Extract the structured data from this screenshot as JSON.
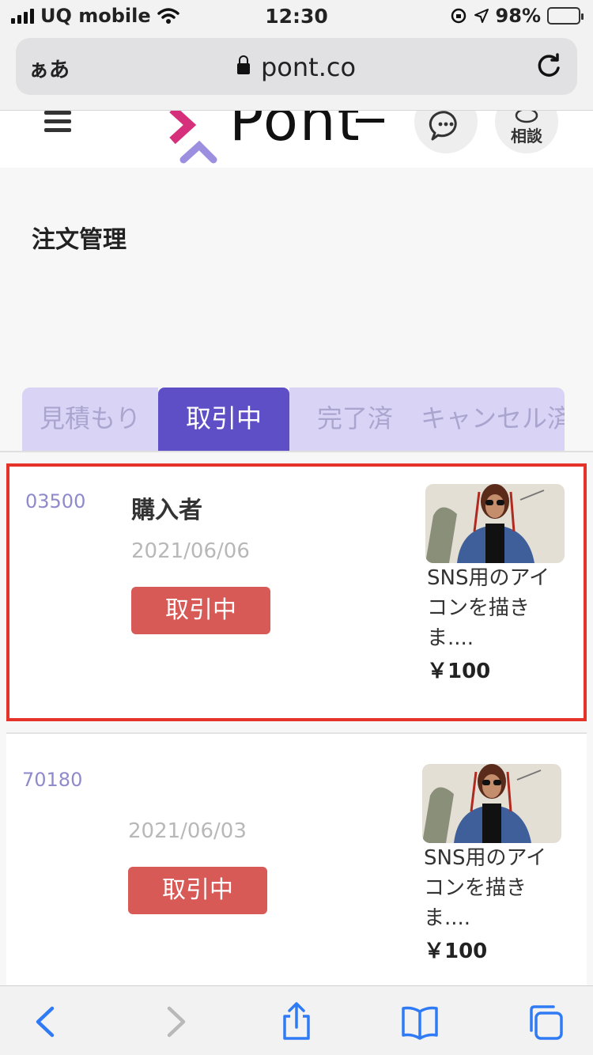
{
  "status_bar": {
    "carrier": "UQ mobile",
    "time": "12:30",
    "battery": "98%",
    "battery_level": 0.98
  },
  "browser": {
    "aa_label": "ぁあ",
    "domain": "pont.co"
  },
  "site": {
    "brand": "Pont",
    "line_button_label": "相談"
  },
  "page": {
    "title": "注文管理"
  },
  "tabs": [
    {
      "label": "見積もり",
      "active": false
    },
    {
      "label": "取引中",
      "active": true
    },
    {
      "label": "完了済",
      "active": false
    },
    {
      "label": "キャンセル済",
      "active": false
    }
  ],
  "orders": [
    {
      "id": "03500",
      "buyer": "購入者",
      "date": "2021/06/06",
      "status": "取引中",
      "product_title": "SNS用のアイコンを描きま....",
      "price": "￥100"
    },
    {
      "id": "70180",
      "buyer": "",
      "date": "2021/06/03",
      "status": "取引中",
      "product_title": "SNS用のアイコンを描きま....",
      "price": "￥100"
    }
  ],
  "colors": {
    "accent": "#5e4fc7",
    "tab_inactive": "#d9d4f6",
    "status_badge": "#d85a57",
    "order_id": "#8e8acb",
    "highlight_border": "#e5332a",
    "ios_blue": "#2f7bf5"
  },
  "icons": {
    "wifi": "wifi-icon",
    "orientation_lock": "orientation-lock-icon",
    "location": "location-arrow-icon",
    "battery": "battery-charging-icon",
    "lock": "lock-icon",
    "reload": "reload-icon",
    "menu": "hamburger-icon",
    "chat": "chat-bubble-icon",
    "line": "line-chat-icon",
    "back": "chevron-left-icon",
    "forward": "chevron-right-icon",
    "share": "share-icon",
    "bookmarks": "book-icon",
    "tabs": "tabs-icon"
  }
}
